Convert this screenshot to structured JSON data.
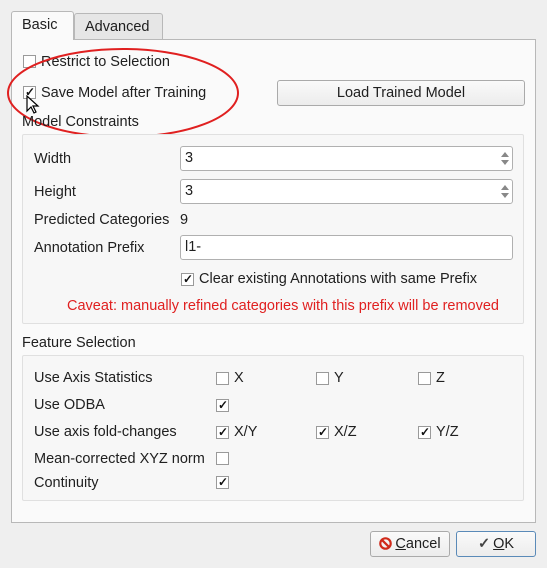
{
  "tabs": [
    {
      "label": "Basic",
      "active": true
    },
    {
      "label": "Advanced",
      "active": false
    }
  ],
  "options": {
    "restrict_to_selection": {
      "label": "Restrict to Selection",
      "checked": false
    },
    "save_model": {
      "label": "Save Model after Training",
      "checked": true
    },
    "load_button": "Load Trained Model"
  },
  "model_constraints": {
    "title": "Model Constraints",
    "width": {
      "label": "Width",
      "value": "3"
    },
    "height": {
      "label": "Height",
      "value": "3"
    },
    "predicted": {
      "label": "Predicted Categories",
      "value": "9"
    },
    "prefix": {
      "label": "Annotation Prefix",
      "value": "l1-"
    },
    "clear_existing": {
      "label": "Clear existing Annotations with same Prefix",
      "checked": true
    },
    "caveat": "Caveat: manually refined categories with this prefix will be removed"
  },
  "feature_selection": {
    "title": "Feature Selection",
    "axis_stats": {
      "label": "Use Axis Statistics",
      "x": {
        "label": "X",
        "checked": false
      },
      "y": {
        "label": "Y",
        "checked": false
      },
      "z": {
        "label": "Z",
        "checked": false
      }
    },
    "odba": {
      "label": "Use ODBA",
      "checked": true
    },
    "fold_changes": {
      "label": "Use axis fold-changes",
      "xy": {
        "label": "X/Y",
        "checked": true
      },
      "xz": {
        "label": "X/Z",
        "checked": true
      },
      "yz": {
        "label": "Y/Z",
        "checked": true
      }
    },
    "mean_norm": {
      "label": "Mean-corrected XYZ norm",
      "checked": false
    },
    "continuity": {
      "label": "Continuity",
      "checked": true
    }
  },
  "buttons": {
    "cancel_prefix": "C",
    "cancel_rest": "ancel",
    "ok_prefix": "O",
    "ok_rest": "K"
  },
  "colors": {
    "annotation_red": "#e02020",
    "caveat_red": "#e02020"
  },
  "check_glyph": "✓"
}
